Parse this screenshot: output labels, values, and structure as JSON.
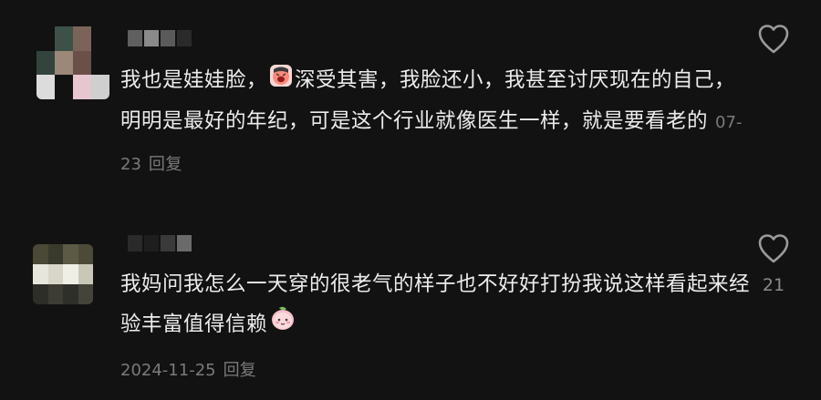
{
  "comments": [
    {
      "avatar_colors": [
        "#121212",
        "#3d5148",
        "#7a6459",
        "#121212",
        "#33443c",
        "#9b8878",
        "#6a5048",
        "#121212",
        "#dcdcdc",
        "#121212",
        "#e8c6cf",
        "#cfcfcf"
      ],
      "username_colors": [
        "#5f5f5f",
        "#8a8a8a",
        "#5a5a5a",
        "#2a2a2a"
      ],
      "text_before_emoji": "我也是娃娃脸，",
      "emoji_name": "crying-face-emoji",
      "text_after_emoji": "深受其害，我脸还小，我甚至讨厌现在的自己，明明是最好的年纪，可是这个行业就像医生一样，就是要看老的",
      "date": "07-23",
      "reply_label": "回复",
      "like_count": ""
    },
    {
      "avatar_colors": [
        "#4a4836",
        "#3a3a2c",
        "#5c5a44",
        "#4d4b38",
        "#e6e6dc",
        "#d8d6c8",
        "#f0efe6",
        "#c9c7b6",
        "#2e2e28",
        "#3c3c34",
        "#2f2f2a",
        "#45443a"
      ],
      "username_colors": [
        "#2a2a2a",
        "#1e1e1e",
        "#3a3a3a",
        "#6a6a6a"
      ],
      "text": "我妈问我怎么一天穿的很老气的样子也不好好打扮我说这样看起来经验丰富值得信赖",
      "emoji_name": "peach-face-emoji",
      "date": "2024-11-25",
      "reply_label": "回复",
      "like_count": "21"
    }
  ]
}
